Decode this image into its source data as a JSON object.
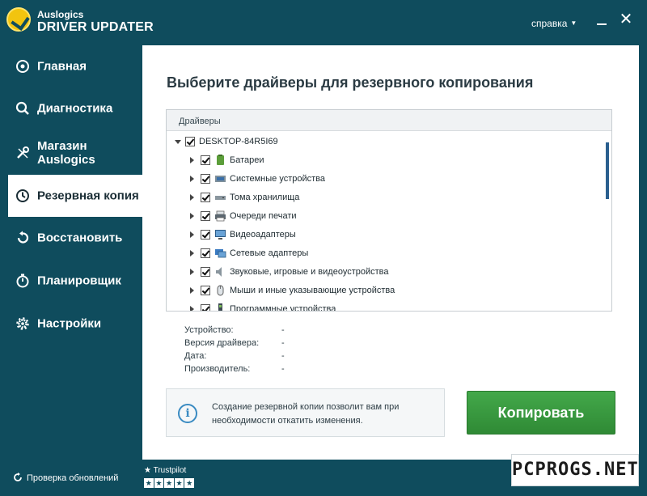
{
  "app": {
    "brand_top": "Auslogics",
    "brand_main": "DRIVER UPDATER",
    "help_label": "справка",
    "close_glyph": "✕"
  },
  "sidebar": {
    "items": [
      {
        "label": "Главная",
        "icon": "target-icon",
        "active": false
      },
      {
        "label": "Диагностика",
        "icon": "search-icon",
        "active": false
      },
      {
        "label": "Магазин Auslogics",
        "icon": "tools-icon",
        "active": false
      },
      {
        "label": "Резервная копия",
        "icon": "clock-icon",
        "active": true
      },
      {
        "label": "Восстановить",
        "icon": "restore-icon",
        "active": false
      },
      {
        "label": "Планировщик",
        "icon": "stopwatch-icon",
        "active": false
      },
      {
        "label": "Настройки",
        "icon": "gear-icon",
        "active": false
      }
    ]
  },
  "main": {
    "heading": "Выберите драйверы для резервного копирования",
    "tree_header": "Драйверы",
    "root": {
      "label": "DESKTOP-84R5I69",
      "checked": true,
      "expanded": true
    },
    "categories": [
      {
        "label": "Батареи",
        "icon": "battery-icon",
        "checked": true
      },
      {
        "label": "Системные устройства",
        "icon": "system-device-icon",
        "checked": true
      },
      {
        "label": "Тома хранилища",
        "icon": "storage-volume-icon",
        "checked": true
      },
      {
        "label": "Очереди печати",
        "icon": "printer-icon",
        "checked": true
      },
      {
        "label": "Видеоадаптеры",
        "icon": "display-adapter-icon",
        "checked": true
      },
      {
        "label": "Сетевые адаптеры",
        "icon": "network-adapter-icon",
        "checked": true
      },
      {
        "label": "Звуковые, игровые и видеоустройства",
        "icon": "speaker-icon",
        "checked": true
      },
      {
        "label": "Мыши и иные указывающие устройства",
        "icon": "mouse-icon",
        "checked": true
      },
      {
        "label": "Программные устройства",
        "icon": "software-device-icon",
        "checked": true
      }
    ],
    "details": {
      "device_label": "Устройство:",
      "device_value": "-",
      "version_label": "Версия драйвера:",
      "version_value": "-",
      "date_label": "Дата:",
      "date_value": "-",
      "vendor_label": "Производитель:",
      "vendor_value": "-"
    },
    "hint_text": "Создание резервной копии позволит вам при необходимости откатить изменения.",
    "copy_button": "Копировать"
  },
  "footer": {
    "update_check": "Проверка обновлений",
    "trustpilot": "Trustpilot"
  },
  "watermark": "PCPROGS.NET",
  "colors": {
    "window_bg": "#0f4c5d",
    "accent_button": "#3a9a40",
    "info_blue": "#3a8bc2",
    "scroll_thumb": "#2a5f8f"
  }
}
